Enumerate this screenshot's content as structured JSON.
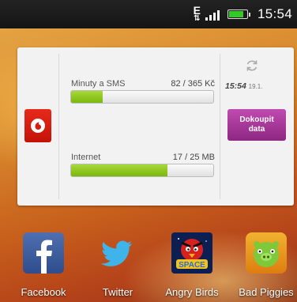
{
  "status_bar": {
    "network": "E",
    "time": "15:54",
    "battery_level": 0.82
  },
  "widget": {
    "sms": {
      "label": "Minuty a SMS",
      "value": "82 / 365 Kč",
      "fraction": 0.2247
    },
    "internet": {
      "label": "Internet",
      "value": "17 / 25 MB",
      "fraction": 0.68
    },
    "updated_time": "15:54",
    "updated_date": "19.1.",
    "buy_button": {
      "line1": "Dokoupit",
      "line2": "data"
    },
    "icons": {
      "logo": "vodafone-logo",
      "refresh": "refresh-icon"
    },
    "colors": {
      "bar_fill": "#8cc820",
      "button": "#a2349a",
      "logo": "#d61d12"
    }
  },
  "dock": {
    "apps": [
      {
        "label": "Facebook",
        "icon": "facebook-icon"
      },
      {
        "label": "Twitter",
        "icon": "twitter-icon"
      },
      {
        "label": "Angry Birds",
        "icon": "angry-birds-space-icon"
      },
      {
        "label": "Bad Piggies",
        "icon": "bad-piggies-icon"
      }
    ]
  }
}
